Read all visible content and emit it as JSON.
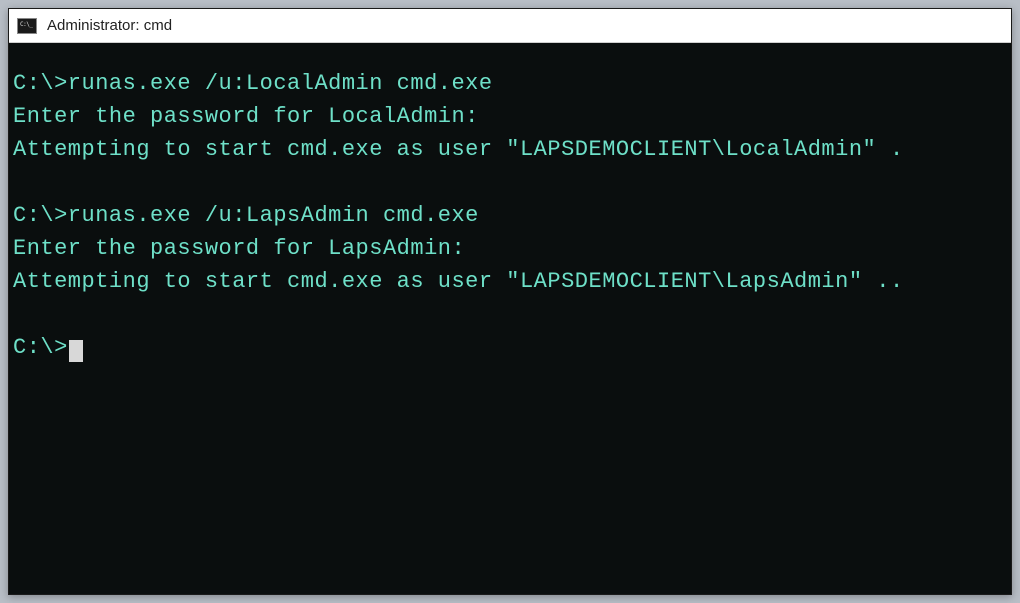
{
  "window": {
    "title": "Administrator: cmd"
  },
  "terminal": {
    "lines": [
      "C:\\>runas.exe /u:LocalAdmin cmd.exe",
      "Enter the password for LocalAdmin:",
      "Attempting to start cmd.exe as user \"LAPSDEMOCLIENT\\LocalAdmin\" .",
      "",
      "C:\\>runas.exe /u:LapsAdmin cmd.exe",
      "Enter the password for LapsAdmin:",
      "Attempting to start cmd.exe as user \"LAPSDEMOCLIENT\\LapsAdmin\" .."
    ],
    "prompt": "C:\\>"
  }
}
